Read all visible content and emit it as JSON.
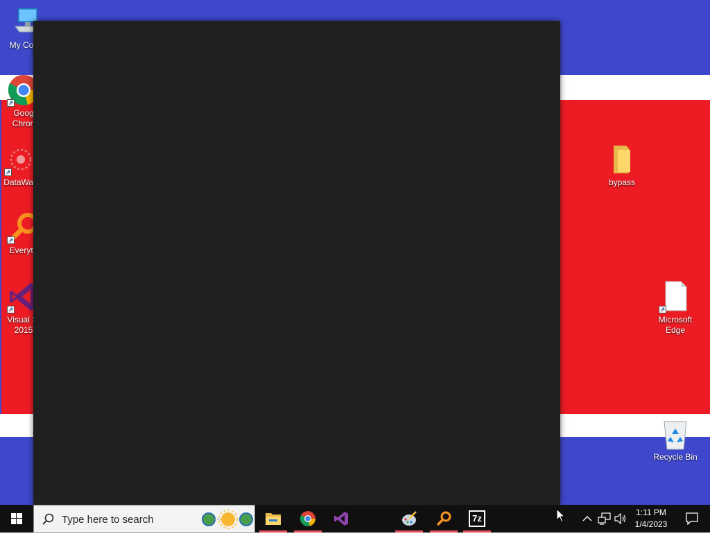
{
  "desktop": {
    "colors": {
      "blue": "#3f48cc",
      "red": "#ed1c24",
      "white": "#ffffff"
    },
    "icons": {
      "my_computer": {
        "label": "My Com",
        "icon": "computer-icon"
      },
      "chrome": {
        "label_line1": "Goog",
        "label_line2": "Chron",
        "icon": "chrome-icon"
      },
      "datawag": {
        "label": "DataWag",
        "icon": "datawag-icon"
      },
      "everything": {
        "label": "Everyth",
        "icon": "everything-search-icon"
      },
      "visual_studio": {
        "label_line1": "Visual St",
        "label_line2": "2015",
        "icon": "visual-studio-icon"
      },
      "bypass": {
        "label": "bypass",
        "icon": "folder-icon"
      },
      "edge": {
        "label_line1": "Microsoft",
        "label_line2": "Edge",
        "icon": "document-icon"
      },
      "recycle_bin": {
        "label": "Recycle Bin",
        "icon": "recycle-bin-icon"
      }
    }
  },
  "window": {
    "background": "#202020"
  },
  "taskbar": {
    "search_placeholder": "Type here to search",
    "apps": [
      {
        "name": "file-explorer",
        "icon": "folder-icon",
        "running": true
      },
      {
        "name": "chrome",
        "icon": "chrome-icon",
        "running": true
      },
      {
        "name": "visual-studio",
        "icon": "visual-studio-icon",
        "running": false
      },
      {
        "name": "paint",
        "icon": "paint-palette-icon",
        "running": true
      },
      {
        "name": "everything",
        "icon": "everything-search-icon",
        "running": true
      },
      {
        "name": "7zip",
        "icon": "7zip-icon",
        "running": true,
        "label": "7z"
      }
    ],
    "clock": {
      "time": "1:11 PM",
      "date": "1/4/2023"
    }
  }
}
